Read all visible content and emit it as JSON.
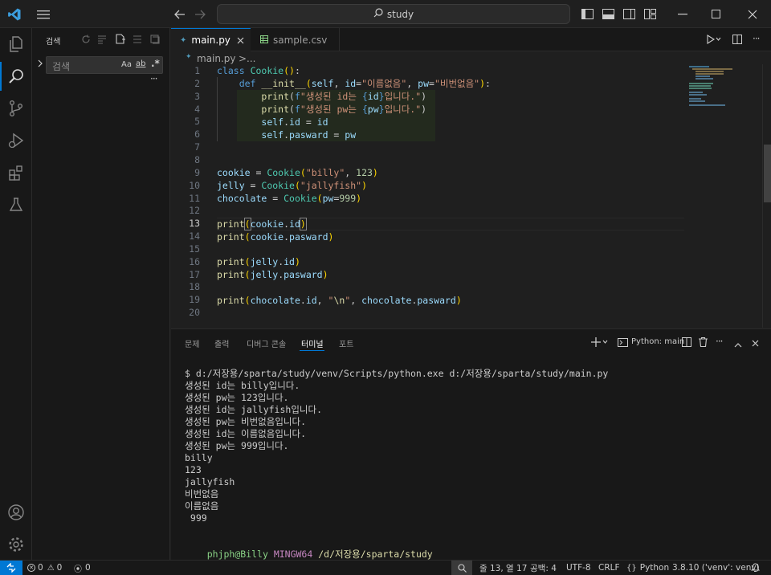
{
  "titlebar": {
    "search_label": "study"
  },
  "sidebar": {
    "title": "검색",
    "search_placeholder": "검색",
    "match_case": "Aa",
    "whole_word": "ab",
    "regex": ".*"
  },
  "tabs": [
    {
      "label": "main.py",
      "active": true
    },
    {
      "label": "sample.csv",
      "active": false
    }
  ],
  "breadcrumb": {
    "file": "main.py",
    "sep": ">",
    "rest": "..."
  },
  "editor": {
    "line_numbers": [
      "1",
      "2",
      "3",
      "4",
      "5",
      "6",
      "7",
      "8",
      "9",
      "10",
      "11",
      "12",
      "13",
      "14",
      "15",
      "16",
      "17",
      "18",
      "19",
      "20"
    ],
    "current_line": 13
  },
  "panel": {
    "tabs": [
      "문제",
      "출력",
      "디버그 콘솔",
      "터미널",
      "포트"
    ],
    "active_tab": "터미널",
    "terminal_name": "Python: main",
    "terminal_lines": [
      "$ d:/저장용/sparta/study/venv/Scripts/python.exe d:/저장용/sparta/study/main.py",
      "생성된 id는 billy입니다.",
      "생성된 pw는 123입니다.",
      "생성된 id는 jallyfish입니다.",
      "생성된 pw는 비번없음입니다.",
      "생성된 id는 이름없음입니다.",
      "생성된 pw는 999입니다.",
      "billy",
      "123",
      "jallyfish",
      "비번없음",
      "이름없음",
      " 999",
      ""
    ],
    "prompt_user": "phjph@Billy",
    "prompt_env": "MINGW64",
    "prompt_path": "/d/저장용/sparta/study",
    "prompt_symbol": "$"
  },
  "status": {
    "errors": "0",
    "warnings": "0",
    "ports": "0",
    "position": "줄 13, 열 17",
    "spaces": "공백: 4",
    "encoding": "UTF-8",
    "eol": "CRLF",
    "language": "Python",
    "interpreter": "3.8.10 ('venv': venv)"
  },
  "colors": {
    "accent": "#0078d4",
    "keyword": "#569cd6",
    "class": "#4ec9b0",
    "function": "#dcdcaa",
    "string": "#ce9178",
    "number": "#b5cea8",
    "variable": "#9cdcfe"
  }
}
